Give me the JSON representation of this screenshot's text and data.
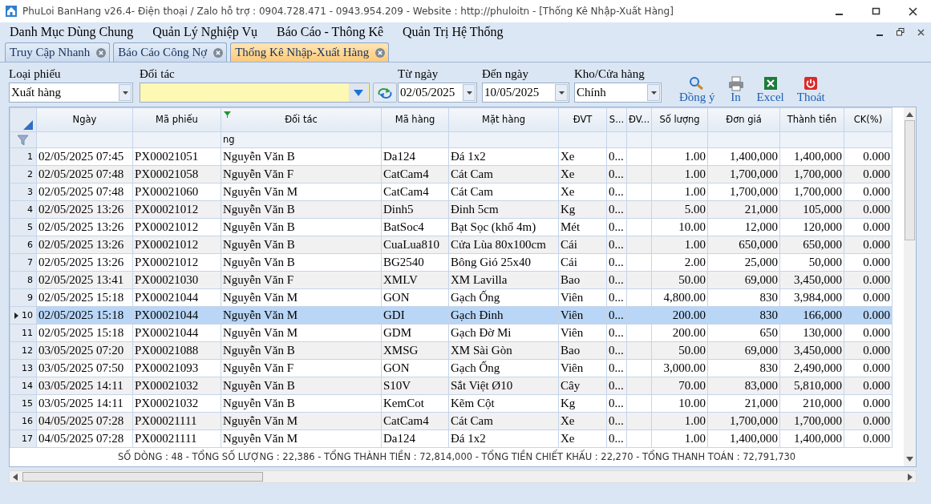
{
  "window": {
    "title": "PhuLoi BanHang v26.4- Điện thoại / Zalo hỗ trợ : 0904.728.471 - 0943.954.209 - Website : http://phuloitn - [Thống Kê Nhập-Xuất Hàng]"
  },
  "menu": [
    {
      "label": "Danh Mục Dùng Chung"
    },
    {
      "label": "Quản Lý Nghiệp Vụ"
    },
    {
      "label": "Báo Cáo - Thông Kê"
    },
    {
      "label": "Quản Trị Hệ Thống"
    }
  ],
  "tabs": [
    {
      "label": "Truy Cập Nhanh",
      "selected": false
    },
    {
      "label": "Báo Cáo Công Nợ",
      "selected": false
    },
    {
      "label": "Thống Kê Nhập-Xuất Hàng",
      "selected": true
    }
  ],
  "filters": [
    {
      "kind": "combo",
      "label": "Loại phiếu",
      "value": "Xuất hàng"
    },
    {
      "kind": "partner",
      "label": "Đối tác"
    },
    {
      "kind": "date",
      "label": "Từ ngày",
      "value": "02/05/2025"
    },
    {
      "kind": "date",
      "label": "Đến ngày",
      "value": "10/05/2025"
    },
    {
      "kind": "combo",
      "label": "Kho/Cửa hàng",
      "value": "Chính"
    }
  ],
  "actions": [
    {
      "kind": "search",
      "label": "Đồng ý"
    },
    {
      "kind": "print",
      "label": "In"
    },
    {
      "kind": "excel",
      "label": "Excel"
    },
    {
      "kind": "exit",
      "label": "Thoát"
    }
  ],
  "table": {
    "columns": [
      {
        "label": "Ngày",
        "filtered": false
      },
      {
        "label": "Mã phiếu",
        "filtered": false
      },
      {
        "label": "Đối tác",
        "filtered": true,
        "filter_text": "ng"
      },
      {
        "label": "Mã hàng",
        "filtered": false
      },
      {
        "label": "Mặt hàng",
        "filtered": false
      },
      {
        "label": "ĐVT",
        "filtered": false
      },
      {
        "label": "S...",
        "filtered": false
      },
      {
        "label": "ĐV...",
        "filtered": false
      },
      {
        "label": "Số lượng",
        "filtered": false
      },
      {
        "label": "Đơn giá",
        "filtered": false
      },
      {
        "label": "Thành tiền",
        "filtered": false
      },
      {
        "label": "CK(%)",
        "filtered": false
      }
    ],
    "rows": [
      {
        "number": "1",
        "selected": false,
        "cells": [
          "02/05/2025 07:45",
          "PX00021051",
          "Nguyễn Văn B",
          "Da124",
          "Đá 1x2",
          "Xe",
          "0...",
          "",
          "1.00",
          "1,400,000",
          "1,400,000",
          "0.000"
        ]
      },
      {
        "number": "2",
        "selected": false,
        "cells": [
          "02/05/2025 07:48",
          "PX00021058",
          "Nguyễn Văn F",
          "CatCam4",
          "Cát Cam",
          "Xe",
          "0...",
          "",
          "1.00",
          "1,700,000",
          "1,700,000",
          "0.000"
        ]
      },
      {
        "number": "3",
        "selected": false,
        "cells": [
          "02/05/2025 07:48",
          "PX00021060",
          "Nguyễn Văn M",
          "CatCam4",
          "Cát Cam",
          "Xe",
          "0...",
          "",
          "1.00",
          "1,700,000",
          "1,700,000",
          "0.000"
        ]
      },
      {
        "number": "4",
        "selected": false,
        "cells": [
          "02/05/2025 13:26",
          "PX00021012",
          "Nguyễn Văn B",
          "Dinh5",
          "Đinh 5cm",
          "Kg",
          "0...",
          "",
          "5.00",
          "21,000",
          "105,000",
          "0.000"
        ]
      },
      {
        "number": "5",
        "selected": false,
        "cells": [
          "02/05/2025 13:26",
          "PX00021012",
          "Nguyễn Văn B",
          "BatSoc4",
          "Bạt Sọc (khổ 4m)",
          "Mét",
          "0...",
          "",
          "10.00",
          "12,000",
          "120,000",
          "0.000"
        ]
      },
      {
        "number": "6",
        "selected": false,
        "cells": [
          "02/05/2025 13:26",
          "PX00021012",
          "Nguyễn Văn B",
          "CuaLua810",
          "Cửa Lùa 80x100cm",
          "Cái",
          "0...",
          "",
          "1.00",
          "650,000",
          "650,000",
          "0.000"
        ]
      },
      {
        "number": "7",
        "selected": false,
        "cells": [
          "02/05/2025 13:26",
          "PX00021012",
          "Nguyễn Văn B",
          "BG2540",
          "Bông Gió 25x40",
          "Cái",
          "0...",
          "",
          "2.00",
          "25,000",
          "50,000",
          "0.000"
        ]
      },
      {
        "number": "8",
        "selected": false,
        "cells": [
          "02/05/2025 13:41",
          "PX00021030",
          "Nguyễn Văn F",
          "XMLV",
          "XM Lavilla",
          "Bao",
          "0...",
          "",
          "50.00",
          "69,000",
          "3,450,000",
          "0.000"
        ]
      },
      {
        "number": "9",
        "selected": false,
        "cells": [
          "02/05/2025 15:18",
          "PX00021044",
          "Nguyễn Văn M",
          "GON",
          "Gạch  Ống",
          "Viên",
          "0...",
          "",
          "4,800.00",
          "830",
          "3,984,000",
          "0.000"
        ]
      },
      {
        "number": "10",
        "selected": true,
        "cells": [
          "02/05/2025 15:18",
          "PX00021044",
          "Nguyễn Văn M",
          "GDI",
          "Gạch Đinh",
          "Viên",
          "0...",
          "",
          "200.00",
          "830",
          "166,000",
          "0.000"
        ]
      },
      {
        "number": "11",
        "selected": false,
        "cells": [
          "02/05/2025 15:18",
          "PX00021044",
          "Nguyễn Văn M",
          "GDM",
          "Gạch Đờ Mi",
          "Viên",
          "0...",
          "",
          "200.00",
          "650",
          "130,000",
          "0.000"
        ]
      },
      {
        "number": "12",
        "selected": false,
        "cells": [
          "03/05/2025 07:20",
          "PX00021088",
          "Nguyễn Văn B",
          "XMSG",
          "XM Sài Gòn",
          "Bao",
          "0...",
          "",
          "50.00",
          "69,000",
          "3,450,000",
          "0.000"
        ]
      },
      {
        "number": "13",
        "selected": false,
        "cells": [
          "03/05/2025 07:50",
          "PX00021093",
          "Nguyễn Văn F",
          "GON",
          "Gạch  Ống",
          "Viên",
          "0...",
          "",
          "3,000.00",
          "830",
          "2,490,000",
          "0.000"
        ]
      },
      {
        "number": "14",
        "selected": false,
        "cells": [
          "03/05/2025 14:11",
          "PX00021032",
          "Nguyễn Văn B",
          "S10V",
          "Sắt Việt Ø10",
          "Cây",
          "0...",
          "",
          "70.00",
          "83,000",
          "5,810,000",
          "0.000"
        ]
      },
      {
        "number": "15",
        "selected": false,
        "cells": [
          "03/05/2025 14:11",
          "PX00021032",
          "Nguyễn Văn B",
          "KemCot",
          "Kẽm Cột",
          "Kg",
          "0...",
          "",
          "10.00",
          "21,000",
          "210,000",
          "0.000"
        ]
      },
      {
        "number": "16",
        "selected": false,
        "cells": [
          "04/05/2025 07:28",
          "PX00021111",
          "Nguyễn Văn M",
          "CatCam4",
          "Cát Cam",
          "Xe",
          "0...",
          "",
          "1.00",
          "1,700,000",
          "1,700,000",
          "0.000"
        ]
      },
      {
        "number": "17",
        "selected": false,
        "cells": [
          "04/05/2025 07:28",
          "PX00021111",
          "Nguyễn Văn M",
          "Da124",
          "Đá 1x2",
          "Xe",
          "0...",
          "",
          "1.00",
          "1,400,000",
          "1,400,000",
          "0.000"
        ]
      }
    ]
  },
  "status_bar": "SỐ DÒNG : 48 - TỔNG SỐ LƯỢNG : 22,386 - TỔNG THÀNH TIỀN : 72,814,000 - TỔNG TIỀN CHIẾT KHẤU : 22,270 - TỔNG THANH TOÁN : 72,791,730"
}
